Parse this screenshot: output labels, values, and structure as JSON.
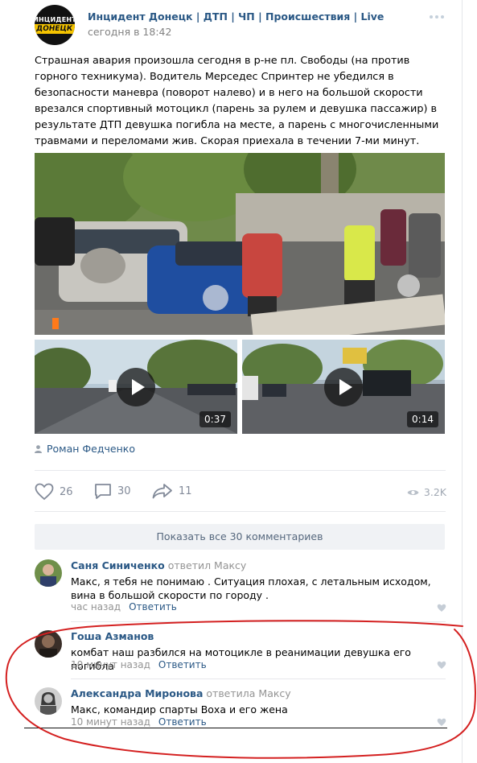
{
  "post": {
    "group_name": "Инцидент Донецк | ДТП | ЧП | Происшествия | Live",
    "avatar_line1": "ИНЦИДЕНТ",
    "avatar_line2": "ДОНЕЦК",
    "time": "сегодня в 18:42",
    "text": "Страшная авария произошла сегодня в р-не пл. Свободы (на против горного техникума). Водитель Мерседес Спринтер не убедился в безопасности маневра (поворот налево) и в него на большой скорости врезался спортивный мотоцикл (парень за рулем и девушка пассажир) в результате ДТП девушка погибла на месте, а парень с многочисленными травмами и переломами жив. Скорая приехала в течении 7-ми минут.",
    "videos": [
      {
        "duration": "0:37"
      },
      {
        "duration": "0:14"
      }
    ],
    "author": "Роман Федченко",
    "likes": "26",
    "comments": "30",
    "shares": "11",
    "views": "3.2K"
  },
  "show_all_comments": "Показать все 30 комментариев",
  "comments": [
    {
      "name": "Саня Синиченко",
      "replied": "ответил Максу",
      "text": "Макс, я тебя не понимаю . Ситуация плохая, с летальным исходом, вина в большой скорости по городу .",
      "time": "час назад",
      "reply_label": "Ответить"
    },
    {
      "name": "Гоша Азманов",
      "replied": "",
      "text": "комбат наш разбился на мотоцикле в реанимации девушка его погибла",
      "time": "10 минут назад",
      "reply_label": "Ответить"
    },
    {
      "name": "Александра Миронова",
      "replied": "ответила Максу",
      "text": "Макс, командир спарты Воха и его жена",
      "time": "10 минут назад",
      "reply_label": "Ответить"
    }
  ],
  "colors": {
    "link": "#2a5885",
    "muted": "#828282",
    "annotation": "#d42020"
  }
}
